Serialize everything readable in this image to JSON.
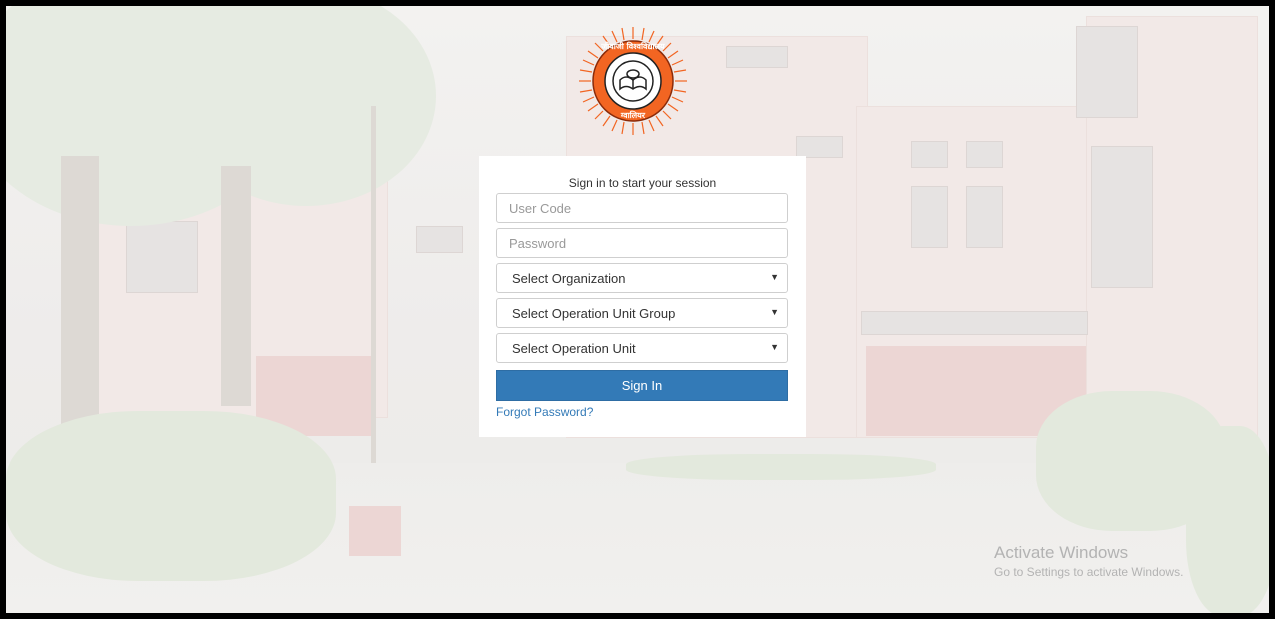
{
  "login": {
    "title": "Sign in to start your session",
    "user_code_placeholder": "User Code",
    "password_placeholder": "Password",
    "organization_select": "Select Organization",
    "unit_group_select": "Select Operation Unit Group",
    "unit_select": "Select Operation Unit",
    "sign_in_label": "Sign In",
    "forgot_password_label": "Forgot Password?"
  },
  "logo": {
    "top_text": "जीवाजी विश्वविद्यालय",
    "bottom_text": "ग्वालियर",
    "icon": "university-emblem-icon"
  },
  "watermark": {
    "title": "Activate Windows",
    "subtitle": "Go to Settings to activate Windows."
  },
  "colors": {
    "primary": "#337ab7",
    "logo_orange": "#f26522",
    "link": "#337ab7"
  }
}
